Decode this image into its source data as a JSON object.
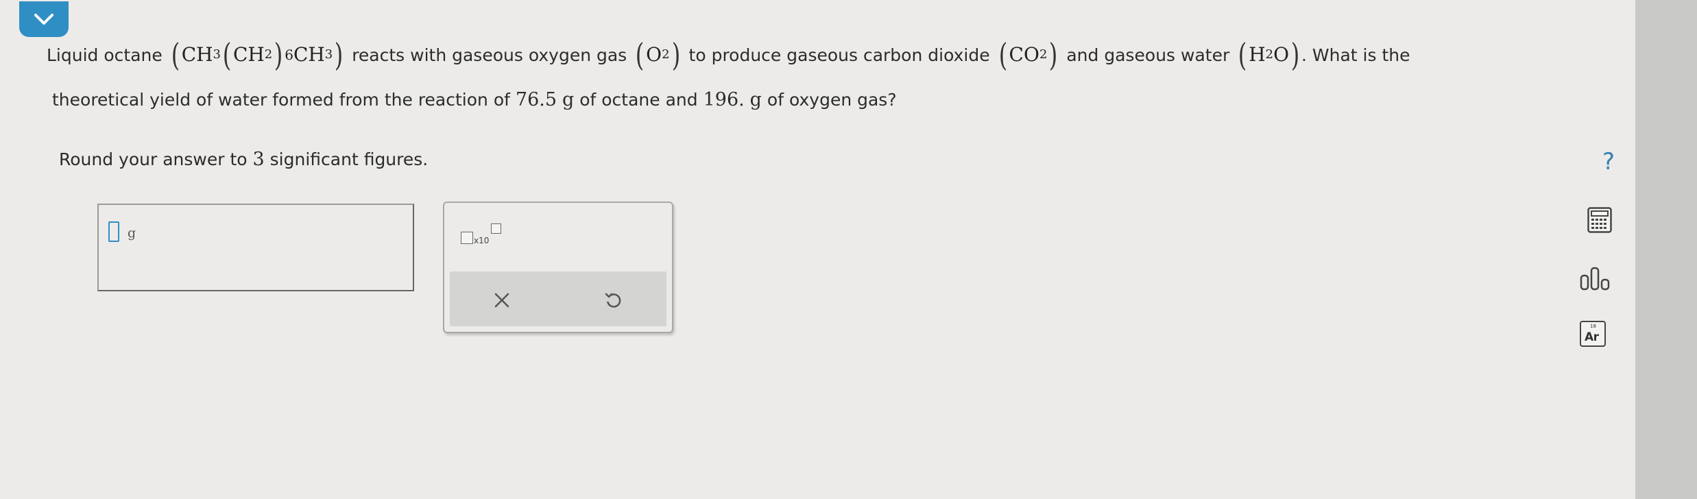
{
  "question": {
    "line1": {
      "seg1": "Liquid octane",
      "octane_ch3": "CH",
      "octane_ch3_sub": "3",
      "octane_ch2": "CH",
      "octane_ch2_sub": "2",
      "octane_repeat": "6",
      "octane_ch3b": "CH",
      "octane_ch3b_sub": "3",
      "seg2": "reacts with gaseous oxygen gas",
      "o2": "O",
      "o2_sub": "2",
      "seg3": "to produce gaseous carbon dioxide",
      "co2": "CO",
      "co2_sub": "2",
      "seg4": "and gaseous water",
      "h2o_h": "H",
      "h2o_sub": "2",
      "h2o_o": "O",
      "seg5": ". What is the"
    },
    "line2": {
      "seg1": "theoretical yield of water formed from the reaction of",
      "octane_mass": "76.5",
      "g1": "g",
      "seg2": "of octane and",
      "oxygen_mass": "196.",
      "g2": "g",
      "seg3": "of oxygen gas?"
    },
    "round_text_pre": "Round your answer to",
    "round_num": "3",
    "round_text_post": "significant figures."
  },
  "answer": {
    "unit": "g"
  },
  "palette": {
    "x10_label": "x10"
  },
  "sidebar": {
    "help_label": "?",
    "periodic_label": "Ar",
    "periodic_number": "18"
  },
  "colors": {
    "accent": "#2f8fc4",
    "page_bg": "#ecebe9",
    "strip": "#c9c9c8"
  }
}
